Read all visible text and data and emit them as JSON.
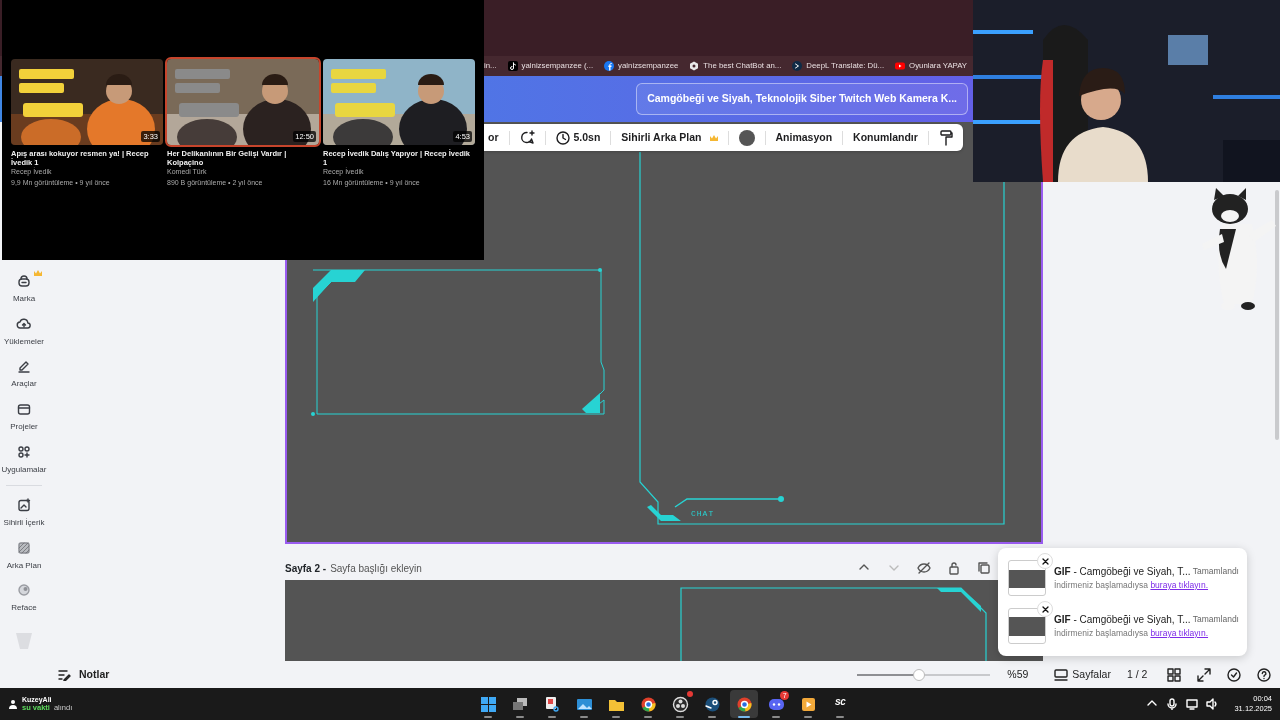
{
  "video_panel": {
    "videos": [
      {
        "title": "Apış arası kokuyor resmen ya! | Recep İvedik 1",
        "channel": "Recep İvedik",
        "meta": "9,9 Mn görüntüleme • 9 yıl önce",
        "duration": "3:33",
        "hovered": false
      },
      {
        "title": "Her Delikanlının Bir Gelişi Vardır | Kolpaçino",
        "channel": "Komedi Türk",
        "meta": "890 B görüntüleme • 2 yıl önce",
        "duration": "12:50",
        "hovered": true
      },
      {
        "title": "Recep İvedik Dalış Yapıyor | Recep İvedik 1",
        "channel": "Recep İvedik",
        "meta": "16 Mn görüntüleme • 9 yıl önce",
        "duration": "4:53",
        "hovered": false
      }
    ]
  },
  "bookmarks": [
    {
      "label": "in...",
      "kind": "none"
    },
    {
      "label": "yalnizsempanzee (...",
      "kind": "tiktok"
    },
    {
      "label": "yalnizsempanzee",
      "kind": "facebook"
    },
    {
      "label": "The best ChatBot an...",
      "kind": "chatbot"
    },
    {
      "label": "DeepL Translate: Dü...",
      "kind": "deepl"
    },
    {
      "label": "Oyunlara YAPAY",
      "kind": "youtube"
    }
  ],
  "design_title": "Camgöbeği ve Siyah, Teknolojik Siber Twitch Web Kamera K...",
  "toolbar": [
    {
      "kind": "text",
      "label": "or"
    },
    {
      "kind": "comment"
    },
    {
      "kind": "duration",
      "label": "5.0sn"
    },
    {
      "kind": "premium",
      "label": "Sihirli Arka Plan"
    },
    {
      "kind": "swatch",
      "color": "#555555"
    },
    {
      "kind": "text",
      "label": "Animasyon"
    },
    {
      "kind": "text",
      "label": "Konumlandır"
    },
    {
      "kind": "roller"
    }
  ],
  "sidebar": {
    "items": [
      {
        "kind": "brand",
        "label": "Marka",
        "premium": true
      },
      {
        "kind": "upload",
        "label": "Yüklemeler",
        "premium": false
      },
      {
        "kind": "tools",
        "label": "Araçlar",
        "premium": false
      },
      {
        "kind": "folder",
        "label": "Projeler",
        "premium": false
      },
      {
        "kind": "apps",
        "label": "Uygulamalar",
        "premium": false
      },
      {
        "kind": "divider"
      },
      {
        "kind": "magic",
        "label": "Sihirli İçerik",
        "premium": false
      },
      {
        "kind": "pattern",
        "label": "Arka Plan",
        "premium": false
      },
      {
        "kind": "reface",
        "label": "Reface",
        "premium": false
      },
      {
        "kind": "faded",
        "premium": false
      }
    ]
  },
  "page1": {
    "canvas_label": "CHAT"
  },
  "page2": {
    "number": "Sayfa 2 -",
    "title_placeholder": "Sayfa başlığı ekleyin",
    "actions": [
      {
        "kind": "up",
        "disabled": false
      },
      {
        "kind": "down",
        "disabled": true
      },
      {
        "kind": "hide",
        "disabled": false
      },
      {
        "kind": "lock",
        "disabled": false
      },
      {
        "kind": "copy",
        "disabled": false
      }
    ]
  },
  "downloads": [
    {
      "title": "**GIF** - Camgöbeği ve Siyah, T...",
      "status": "Tamamlandı",
      "hint": "İndirmeniz başlamadıysa ",
      "link": "buraya tıklayın."
    },
    {
      "title": "**GIF** - Camgöbeği ve Siyah, T...",
      "status": "Tamamlandı",
      "hint": "İndirmeniz başlamadıysa ",
      "link": "buraya tıklayın."
    }
  ],
  "bottom_bar": {
    "notes": "Notlar",
    "zoom": {
      "level": 0.46,
      "reading": "%59"
    },
    "pages": "Sayfalar",
    "page_count": "1 / 2",
    "icons": [
      {
        "kind": "grid"
      },
      {
        "kind": "expand"
      },
      {
        "kind": "check"
      },
      {
        "kind": "help"
      }
    ]
  },
  "taskbar": {
    "user": "KuzeyAli",
    "notice_highlight": "su vakti",
    "notice_rest": "alındı",
    "apps": [
      {
        "kind": "start",
        "active": false
      },
      {
        "kind": "taskview",
        "active": false
      },
      {
        "kind": "snip",
        "active": false
      },
      {
        "kind": "photos",
        "active": false
      },
      {
        "kind": "explorer",
        "active": false
      },
      {
        "kind": "chrome",
        "active": false
      },
      {
        "kind": "obs",
        "active": false,
        "dot": true
      },
      {
        "kind": "steam",
        "active": false
      },
      {
        "kind": "chrome",
        "active": true
      },
      {
        "kind": "discord",
        "active": false,
        "badge": "7"
      },
      {
        "kind": "player",
        "active": false
      },
      {
        "kind": "sc",
        "active": false,
        "label": "SC"
      }
    ],
    "tray": [
      {
        "kind": "chevron"
      },
      {
        "kind": "mic"
      },
      {
        "kind": "display"
      },
      {
        "kind": "speaker"
      }
    ],
    "time": "00:04",
    "date": "31.12.2025"
  }
}
